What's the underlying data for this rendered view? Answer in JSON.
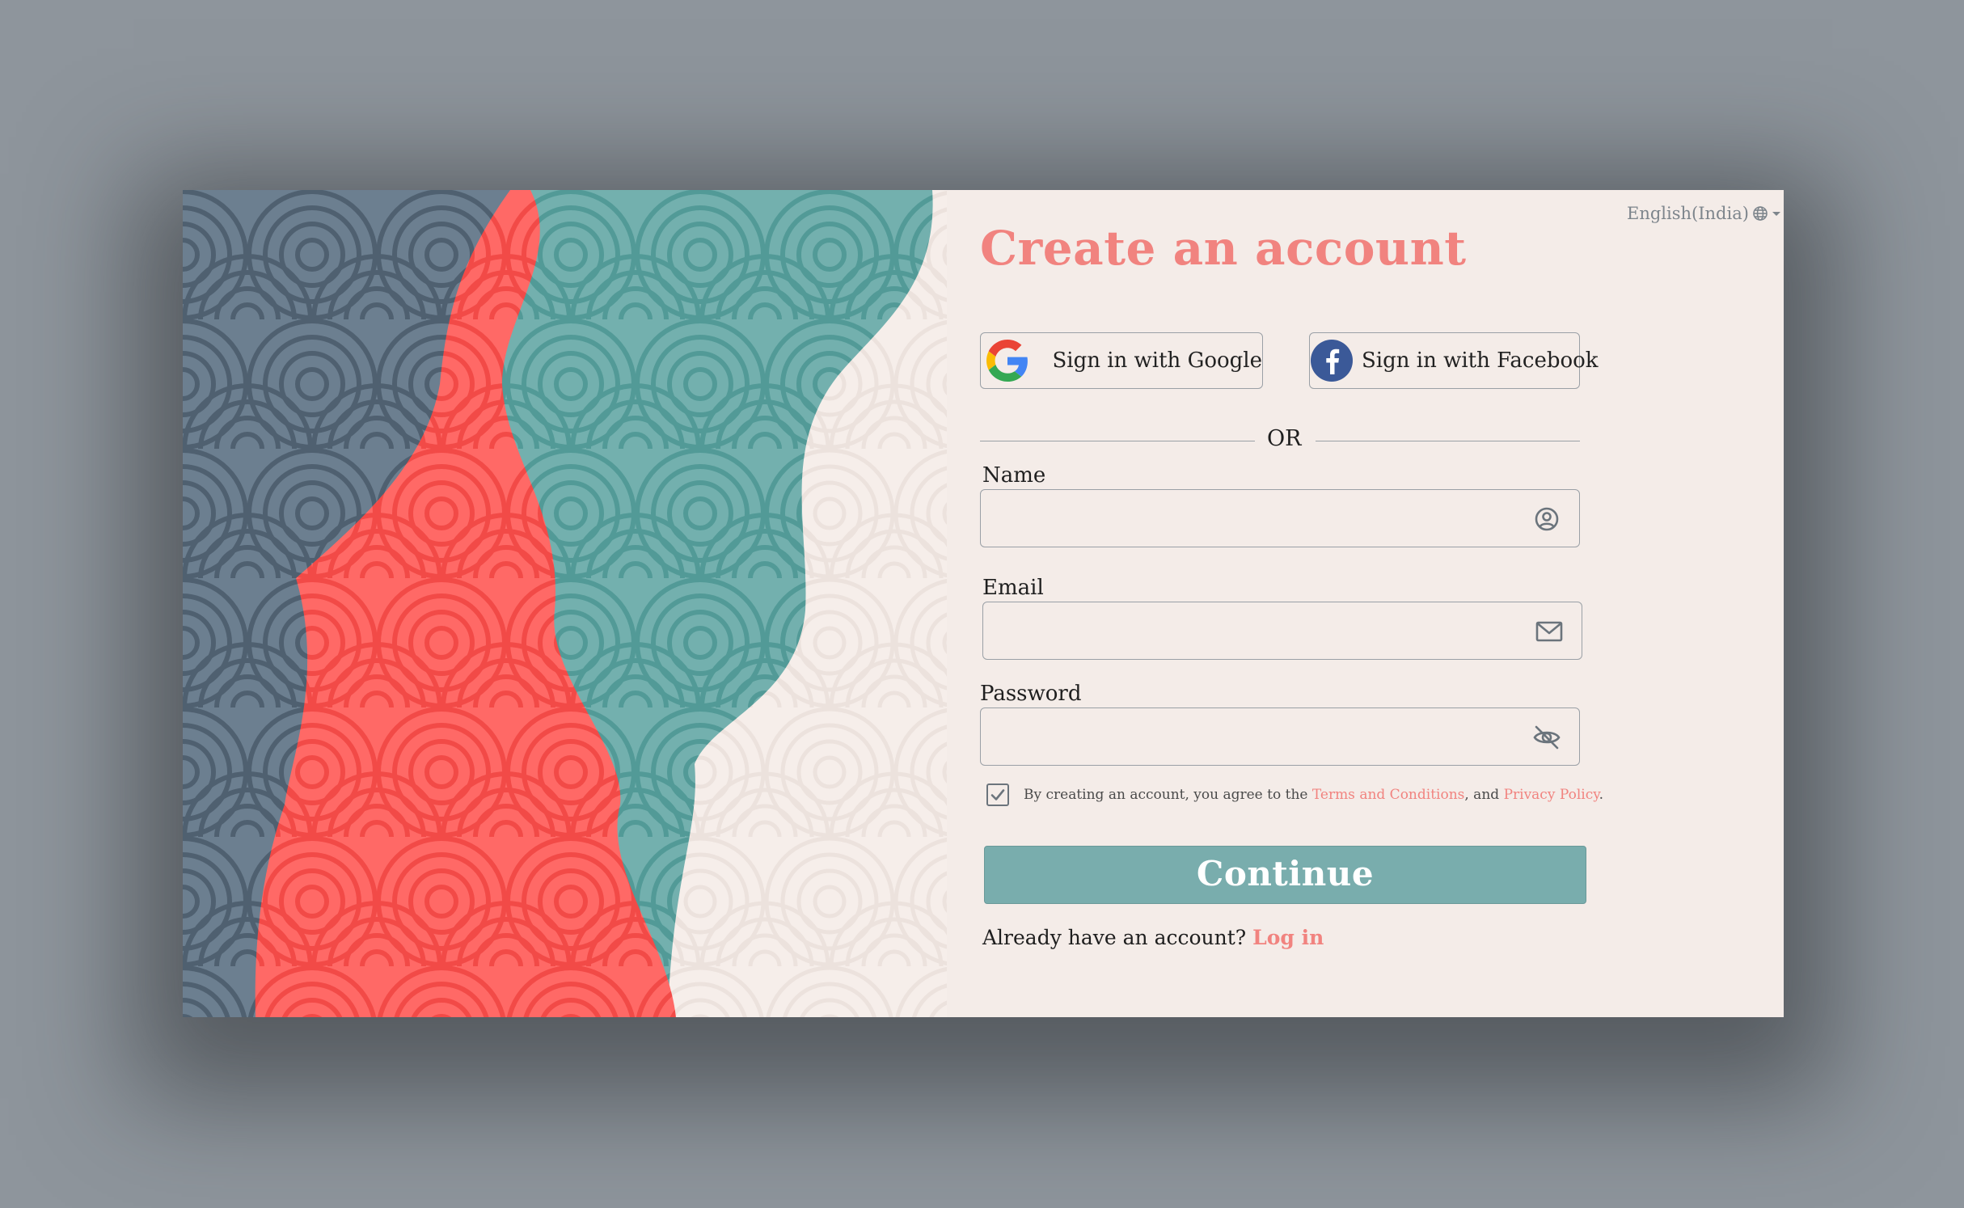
{
  "language": {
    "label": "English(India)",
    "icon": "globe-icon",
    "dropdown_icon": "caret-down-icon"
  },
  "title": "Create an account",
  "social": {
    "google": {
      "label": "Sign in with Google",
      "icon": "google-logo-icon"
    },
    "facebook": {
      "label": "Sign in with Facebook",
      "icon": "facebook-logo-icon"
    }
  },
  "divider_text": "OR",
  "fields": {
    "name": {
      "label": "Name",
      "value": "",
      "placeholder": "",
      "icon": "user-circle-icon"
    },
    "email": {
      "label": "Email",
      "value": "",
      "placeholder": "",
      "icon": "envelope-icon"
    },
    "password": {
      "label": "Password",
      "value": "",
      "placeholder": "",
      "icon": "eye-slash-icon"
    }
  },
  "terms": {
    "checked": true,
    "prefix": "By creating an account, you agree to the ",
    "terms_link": "Terms and Conditions",
    "middle": ", and ",
    "privacy_link": "Privacy Policy",
    "suffix": "."
  },
  "continue_label": "Continue",
  "login": {
    "prompt": "Already have an account? ",
    "link": "Log in"
  },
  "colors": {
    "accent": "#f1837f",
    "button": "#79adad",
    "panel_background": "#f4ece8",
    "page_background": "#8e959c",
    "wave_slate": "#6c7f90",
    "wave_coral": "#ff6966",
    "wave_teal": "#73b0ae"
  }
}
